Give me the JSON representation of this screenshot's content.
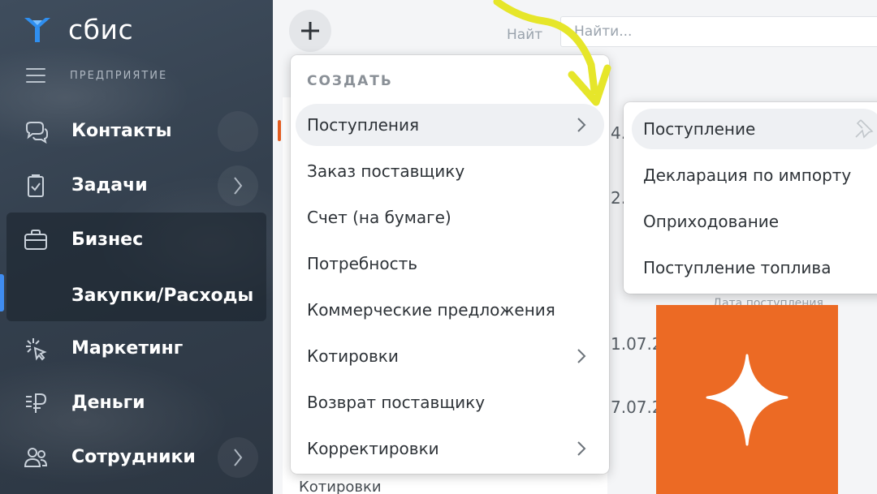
{
  "app": {
    "logo_text": "сбис",
    "company_label": "ПРЕДПРИЯТИЕ"
  },
  "sidebar": {
    "items": [
      {
        "label": "Контакты",
        "icon": "chat-bubbles-icon",
        "has_chevron": false
      },
      {
        "label": "Задачи",
        "icon": "clipboard-check-icon",
        "has_chevron": true
      },
      {
        "label": "Бизнес",
        "icon": "briefcase-icon",
        "has_chevron": false
      },
      {
        "label": "Маркетинг",
        "icon": "sparkle-cursor-icon",
        "has_chevron": false
      },
      {
        "label": "Деньги",
        "icon": "ruble-icon",
        "has_chevron": false
      },
      {
        "label": "Сотрудники",
        "icon": "people-icon",
        "has_chevron": true
      }
    ],
    "active_sub_item": "Закупки/Расходы"
  },
  "toolbar": {
    "add_button_icon": "plus-icon",
    "search_ghost": "Найт",
    "search_placeholder": "Найти..."
  },
  "background": {
    "dates": [
      "4.",
      "2.",
      "1.07.2",
      "7.07.2"
    ],
    "caption": "Дата поступления",
    "bottom_text": "Котировки"
  },
  "create_menu": {
    "header": "СОЗДАТЬ",
    "items": [
      {
        "label": "Поступления",
        "has_submenu": true,
        "active": true
      },
      {
        "label": "Заказ поставщику",
        "has_submenu": false
      },
      {
        "label": "Счет (на бумаге)",
        "has_submenu": false
      },
      {
        "label": "Потребность",
        "has_submenu": false
      },
      {
        "label": "Коммерческие предложения",
        "has_submenu": false
      },
      {
        "label": "Котировки",
        "has_submenu": true
      },
      {
        "label": "Возврат поставщику",
        "has_submenu": false
      },
      {
        "label": "Корректировки",
        "has_submenu": true
      }
    ]
  },
  "submenu": {
    "items": [
      {
        "label": "Поступление",
        "active": true
      },
      {
        "label": "Декларация по импорту"
      },
      {
        "label": "Оприходование"
      },
      {
        "label": "Поступление топлива"
      }
    ],
    "pin_icon": "pin-icon"
  },
  "colors": {
    "sidebar_bg": "#38444f",
    "accent_blue": "#3f8cf0",
    "logo_blue": "#2f8ff0",
    "sticker_orange": "#ec6a24",
    "arrow_yellow": "#e6e62a"
  }
}
